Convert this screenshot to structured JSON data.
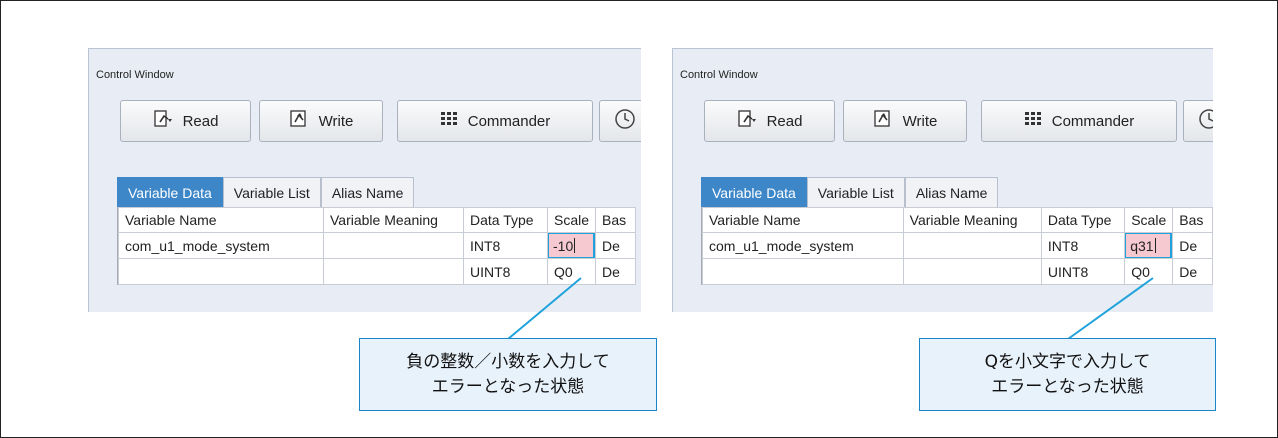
{
  "windows": [
    {
      "title": "Control Window",
      "buttons": [
        "Read",
        "Write",
        "Commander"
      ],
      "tabs": [
        "Variable Data",
        "Variable List",
        "Alias Name"
      ],
      "active_tab": "Variable Data",
      "columns": [
        "Variable Name",
        "Variable Meaning",
        "Data Type",
        "Scale",
        "Bas"
      ],
      "rows": [
        [
          "com_u1_mode_system",
          "",
          "INT8",
          "-10",
          "De"
        ],
        [
          "",
          "",
          "UINT8",
          "Q0",
          "De"
        ]
      ],
      "error_cell_value": "-10",
      "callout_lines": [
        "負の整数／小数を入力して",
        "エラーとなった状態"
      ]
    },
    {
      "title": "Control Window",
      "buttons": [
        "Read",
        "Write",
        "Commander"
      ],
      "tabs": [
        "Variable Data",
        "Variable List",
        "Alias Name"
      ],
      "active_tab": "Variable Data",
      "columns": [
        "Variable Name",
        "Variable Meaning",
        "Data Type",
        "Scale",
        "Bas"
      ],
      "rows": [
        [
          "com_u1_mode_system",
          "",
          "INT8",
          "q31",
          "De"
        ],
        [
          "",
          "",
          "UINT8",
          "Q0",
          "De"
        ]
      ],
      "error_cell_value": "q31",
      "callout_lines": [
        "Qを小文字で入力して",
        "エラーとなった状態"
      ]
    }
  ],
  "colors": {
    "active_tab": "#3d87c9",
    "error_cell": "#f6c9d0",
    "highlight_border": "#1fa2dc",
    "callout_bg": "#e8f2fb",
    "callout_border": "#1a86c8"
  },
  "icons": [
    "read-icon",
    "write-icon",
    "commander-icon",
    "clock-icon"
  ]
}
